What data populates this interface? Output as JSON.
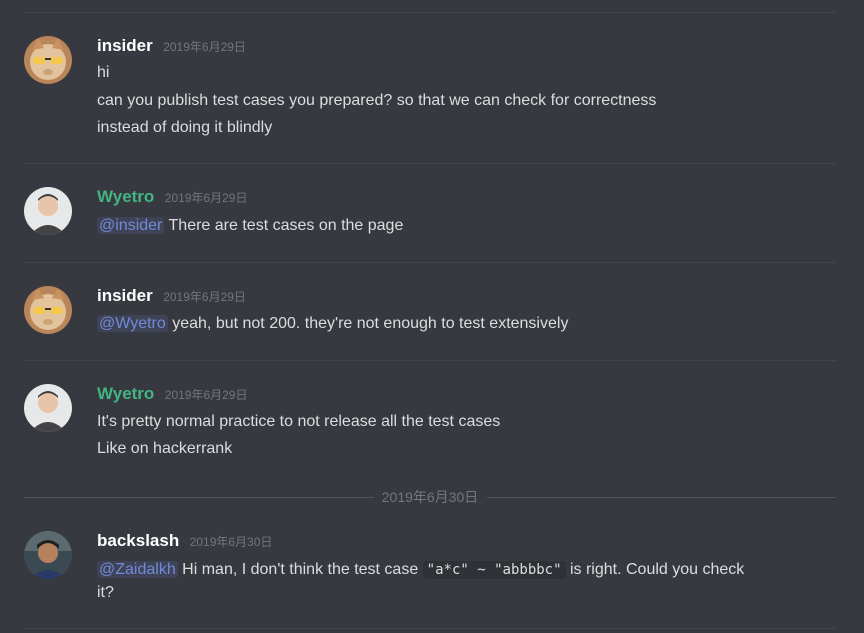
{
  "messages": [
    {
      "username": "insider",
      "username_color": "#ffffff",
      "timestamp": "2019年6月29日",
      "avatar": "cat-sunglasses-avatar",
      "lines": [
        "hi",
        "can you publish test cases you prepared? so that we can check for correctness",
        "instead of doing it blindly"
      ]
    },
    {
      "username": "Wyetro",
      "username_color": "#43b581",
      "timestamp": "2019年6月29日",
      "avatar": "person-photo-avatar",
      "mention": "@insider",
      "text": " There are test cases on the page"
    },
    {
      "username": "insider",
      "username_color": "#ffffff",
      "timestamp": "2019年6月29日",
      "avatar": "cat-sunglasses-avatar",
      "mention": "@Wyetro",
      "text": " yeah, but not 200. they're not enough to test extensively"
    },
    {
      "username": "Wyetro",
      "username_color": "#43b581",
      "timestamp": "2019年6月29日",
      "avatar": "person-photo-avatar",
      "lines": [
        "It's pretty normal practice to not release all the test cases",
        "Like on hackerrank"
      ]
    },
    {
      "username": "backslash",
      "username_color": "#ffffff",
      "timestamp": "2019年6月30日",
      "avatar": "person-dark-photo-avatar",
      "mention": "@Zaidalkh",
      "text_before": " Hi man, I don't think the test case ",
      "code": "\"a*c\" ~ \"abbbbc\"",
      "text_after": " is right. Could you check",
      "continuation": "it?"
    }
  ],
  "date_separator": "2019年6月30日",
  "colors": {
    "background": "#36393f",
    "mention": "#7289da",
    "green_role": "#43b581",
    "timestamp": "#72767d"
  }
}
